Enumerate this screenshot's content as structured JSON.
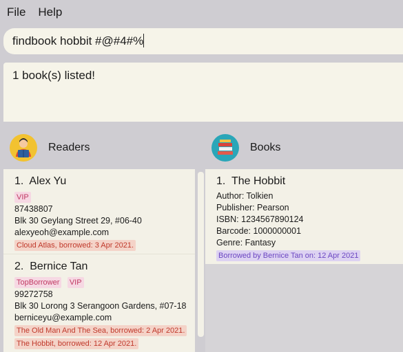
{
  "menu": {
    "file": "File",
    "help": "Help"
  },
  "command": {
    "value": "findbook hobbit #@#4#%"
  },
  "result": {
    "message": "1 book(s) listed!"
  },
  "readers_panel": {
    "title": "Readers",
    "icon": "reader-avatar-icon"
  },
  "books_panel": {
    "title": "Books",
    "icon": "books-stack-icon"
  },
  "readers": [
    {
      "index": "1.",
      "name": "Alex Yu",
      "tags": [
        "VIP"
      ],
      "phone": "87438807",
      "address": "Blk 30 Geylang Street 29, #06-40",
      "email": "alexyeoh@example.com",
      "borrowed": [
        "Cloud Atlas, borrowed: 3 Apr 2021."
      ]
    },
    {
      "index": "2.",
      "name": "Bernice Tan",
      "tags": [
        "TopBorrower",
        "VIP"
      ],
      "phone": "99272758",
      "address": "Blk 30 Lorong 3 Serangoon Gardens, #07-18",
      "email": "berniceyu@example.com",
      "borrowed": [
        "The Old Man And The Sea, borrowed: 2 Apr 2021.",
        "The Hobbit, borrowed: 12 Apr 2021."
      ]
    }
  ],
  "books": [
    {
      "index": "1.",
      "title": "The Hobbit",
      "author": "Author: Tolkien",
      "publisher": "Publisher: Pearson",
      "isbn": "ISBN: 1234567890124",
      "barcode": "Barcode: 1000000001",
      "genre": "Genre: Fantasy",
      "status": "Borrowed by Bernice Tan on: 12 Apr 2021"
    }
  ],
  "colors": {
    "background": "#cfcdd2",
    "panel": "#f3f1e7",
    "tag_pink": "#f6d8e3",
    "tag_red": "#f4d3c8",
    "tag_purple": "#ddd2f2"
  }
}
